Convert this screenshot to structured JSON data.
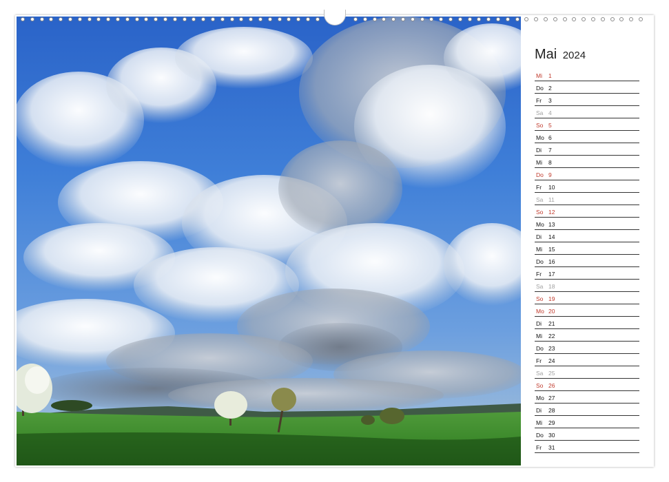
{
  "calendar": {
    "month": "Mai",
    "year": "2024",
    "colors": {
      "holiday": "#c0392b",
      "saturday": "#a0a0a0",
      "normal": "#111111"
    },
    "days": [
      {
        "weekday": "Mi",
        "day": "1",
        "kind": "holiday"
      },
      {
        "weekday": "Do",
        "day": "2",
        "kind": "normal"
      },
      {
        "weekday": "Fr",
        "day": "3",
        "kind": "normal"
      },
      {
        "weekday": "Sa",
        "day": "4",
        "kind": "saturday"
      },
      {
        "weekday": "So",
        "day": "5",
        "kind": "holiday"
      },
      {
        "weekday": "Mo",
        "day": "6",
        "kind": "normal"
      },
      {
        "weekday": "Di",
        "day": "7",
        "kind": "normal"
      },
      {
        "weekday": "Mi",
        "day": "8",
        "kind": "normal"
      },
      {
        "weekday": "Do",
        "day": "9",
        "kind": "holiday"
      },
      {
        "weekday": "Fr",
        "day": "10",
        "kind": "normal"
      },
      {
        "weekday": "Sa",
        "day": "11",
        "kind": "saturday"
      },
      {
        "weekday": "So",
        "day": "12",
        "kind": "holiday"
      },
      {
        "weekday": "Mo",
        "day": "13",
        "kind": "normal"
      },
      {
        "weekday": "Di",
        "day": "14",
        "kind": "normal"
      },
      {
        "weekday": "Mi",
        "day": "15",
        "kind": "normal"
      },
      {
        "weekday": "Do",
        "day": "16",
        "kind": "normal"
      },
      {
        "weekday": "Fr",
        "day": "17",
        "kind": "normal"
      },
      {
        "weekday": "Sa",
        "day": "18",
        "kind": "saturday"
      },
      {
        "weekday": "So",
        "day": "19",
        "kind": "holiday"
      },
      {
        "weekday": "Mo",
        "day": "20",
        "kind": "holiday"
      },
      {
        "weekday": "Di",
        "day": "21",
        "kind": "normal"
      },
      {
        "weekday": "Mi",
        "day": "22",
        "kind": "normal"
      },
      {
        "weekday": "Do",
        "day": "23",
        "kind": "normal"
      },
      {
        "weekday": "Fr",
        "day": "24",
        "kind": "normal"
      },
      {
        "weekday": "Sa",
        "day": "25",
        "kind": "saturday"
      },
      {
        "weekday": "So",
        "day": "26",
        "kind": "holiday"
      },
      {
        "weekday": "Mo",
        "day": "27",
        "kind": "normal"
      },
      {
        "weekday": "Di",
        "day": "28",
        "kind": "normal"
      },
      {
        "weekday": "Mi",
        "day": "29",
        "kind": "normal"
      },
      {
        "weekday": "Do",
        "day": "30",
        "kind": "normal"
      },
      {
        "weekday": "Fr",
        "day": "31",
        "kind": "normal"
      }
    ]
  },
  "photo": {
    "subject": "sky-clouds-meadow-photo"
  }
}
